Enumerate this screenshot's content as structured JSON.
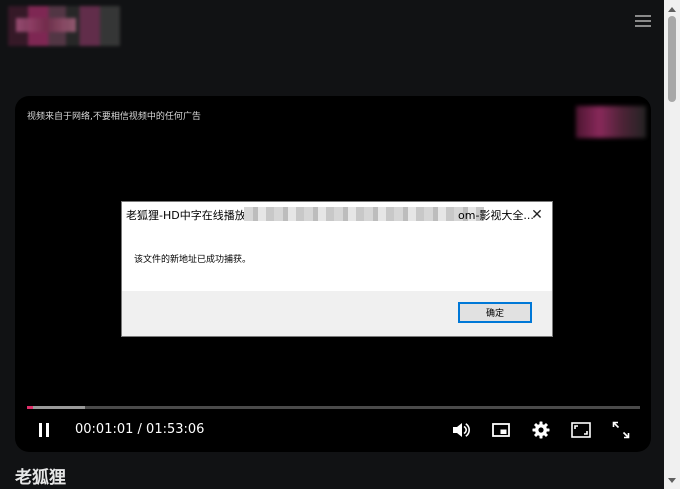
{
  "player": {
    "notice": "视频来自于网络,不要相信视频中的任何广告",
    "current_time": "00:01:01",
    "separator": " / ",
    "duration": "01:53:06",
    "progress_played": 0.0092,
    "progress_buffered": 0.094
  },
  "dialog": {
    "title_prefix": "老狐狸-HD中字在线播放",
    "title_suffix": "om-影视大全...",
    "message": "该文件的新地址已成功捕获。",
    "ok_label": "确定"
  },
  "page": {
    "title": "老狐狸"
  },
  "colors": {
    "accent": "#e0306a",
    "background": "#111214"
  }
}
